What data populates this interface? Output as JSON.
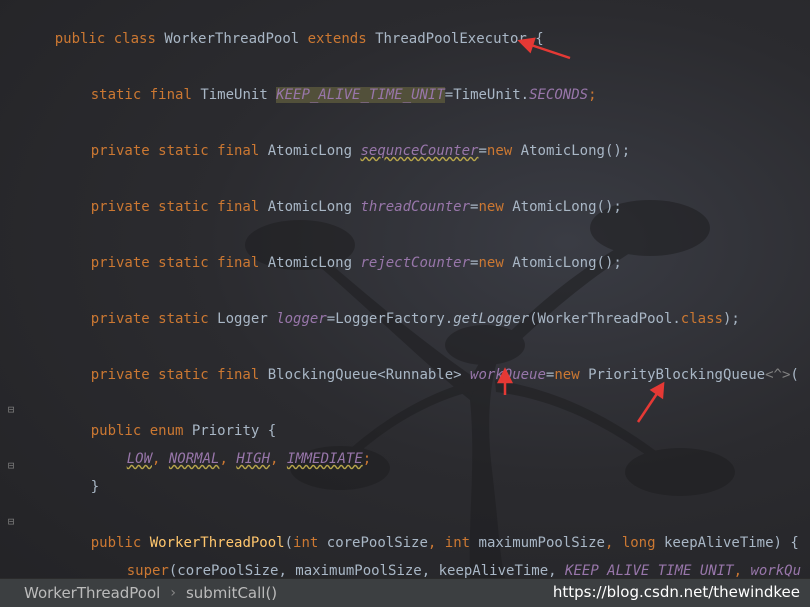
{
  "code": {
    "line1": {
      "public": "public",
      "class": "class",
      "name": "WorkerThreadPool",
      "extends": "extends",
      "parent": "ThreadPoolExecutor",
      "brace": "{"
    },
    "line2": {
      "static": "static",
      "final": "final",
      "type": "TimeUnit",
      "field": "KEEP_ALIVE_TIME_UNIT",
      "eq": "=",
      "val": "TimeUnit.",
      "const": "SECONDS",
      "end": ";"
    },
    "line3": {
      "mods": "private static final",
      "type": "AtomicLong",
      "field": "sequnceCounter",
      "eq": "=",
      "new": "new",
      "ctor": "AtomicLong",
      "end": "();"
    },
    "line4": {
      "mods": "private static final",
      "type": "AtomicLong",
      "field": "threadCounter",
      "eq": "=",
      "new": "new",
      "ctor": "AtomicLong",
      "end": "();"
    },
    "line5": {
      "mods": "private static final",
      "type": "AtomicLong",
      "field": "rejectCounter",
      "eq": "=",
      "new": "new",
      "ctor": "AtomicLong",
      "end": "();"
    },
    "line6": {
      "mods": "private static",
      "type": "Logger",
      "field": "logger",
      "eq": "=",
      "call": "LoggerFactory.",
      "method": "getLogger",
      "arg": "(WorkerThreadPool.",
      "class": "class",
      "end": ");"
    },
    "line7": {
      "mods": "private static final",
      "type": "BlockingQueue<Runnable>",
      "field": "workQueue",
      "eq": "=",
      "new": "new",
      "ctor": "PriorityBlockingQueue",
      "gen": "<^>",
      "end": "("
    },
    "line8": {
      "mods": "public enum",
      "name": "Priority",
      "brace": "{"
    },
    "line9": {
      "v1": "LOW",
      "v2": "NORMAL",
      "v3": "HIGH",
      "v4": "IMMEDIATE",
      "sep": ", ",
      "end": ";"
    },
    "line10": {
      "brace": "}"
    },
    "line11": {
      "public": "public",
      "name": "WorkerThreadPool",
      "p1t": "int",
      "p1": "corePoolSize",
      "p2t": "int",
      "p2": "maximumPoolSize",
      "p3t": "long",
      "p3": "keepAliveTime",
      "end": ") {"
    },
    "line12": {
      "super": "super",
      "args": "(corePoolSize, maximumPoolSize, keepAliveTime, ",
      "f1": "KEEP_ALIVE_TIME_UNIT",
      "sep": ", ",
      "f2": "workQu"
    }
  },
  "breadcrumb": {
    "items": [
      "WorkerThreadPool",
      "submitCall()"
    ],
    "separator": "›"
  },
  "watermark": "https://blog.csdn.net/thewindkee",
  "colors": {
    "keyword": "#cc7832",
    "text": "#a9b7c6",
    "field": "#9876aa",
    "method": "#ffc66d",
    "arrow": "#e53935"
  }
}
